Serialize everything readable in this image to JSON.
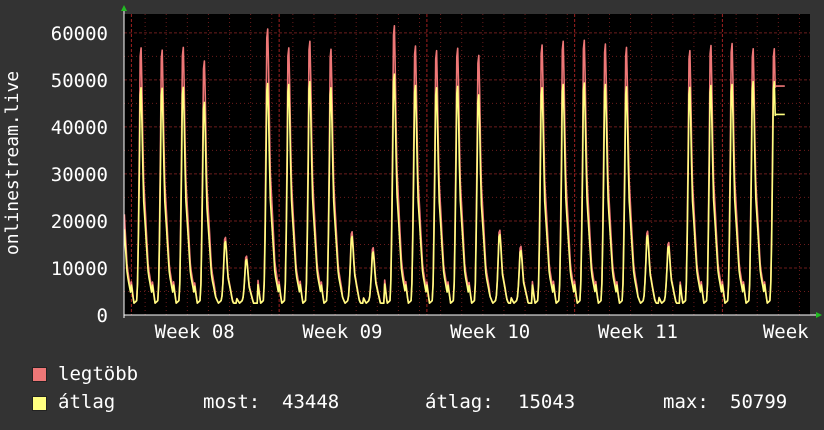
{
  "chart_data": {
    "type": "line",
    "ylabel": "onlinestream.live",
    "ylim": [
      0,
      64000
    ],
    "yticks": [
      0,
      10000,
      20000,
      30000,
      40000,
      50000,
      60000
    ],
    "ytick_labels": [
      "0",
      "10000",
      "20000",
      "30000",
      "40000",
      "50000",
      "60000"
    ],
    "xlim": [
      0,
      32.5
    ],
    "xtick_labels": [
      "Week 08",
      "Week 09",
      "Week 10",
      "Week 11",
      "Week"
    ],
    "xtick_positions": [
      3.35,
      10.35,
      17.35,
      24.35,
      31.35
    ],
    "grid": true,
    "colors": {
      "background": "#000000",
      "grid": "#6b1c1c",
      "axis": "#ffffff",
      "max_series": "#ee7777",
      "avg_series": "#ffff80"
    },
    "series": [
      {
        "name": "legtöbb",
        "color": "#ee7777",
        "daily_peaks": [
          56800,
          56300,
          56900,
          54000,
          16500,
          12500,
          60800,
          56800,
          58200,
          56500,
          17700,
          14300,
          61500,
          57200,
          56200,
          56700,
          55200,
          18000,
          14600,
          57400,
          58200,
          58400,
          57600,
          56900,
          17800,
          15400,
          56200,
          57300,
          57700,
          56600
        ]
      },
      {
        "name": "átlag",
        "color": "#ffff80",
        "daily_peaks": [
          48300,
          48200,
          48400,
          45200,
          15600,
          11800,
          49200,
          49000,
          49600,
          48300,
          16700,
          13400,
          51200,
          48800,
          48300,
          48600,
          46800,
          17100,
          13700,
          48300,
          49000,
          49300,
          49000,
          48500,
          16900,
          14600,
          48400,
          48800,
          49000,
          49600
        ]
      }
    ],
    "stats": [
      {
        "label": "most:",
        "value": "43448"
      },
      {
        "label": "átlag:",
        "value": "15043"
      },
      {
        "label": "max:",
        "value": "50799"
      }
    ]
  }
}
